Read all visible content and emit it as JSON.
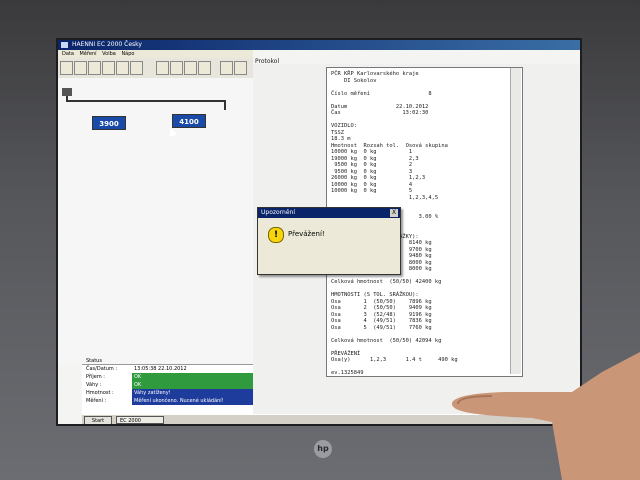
{
  "window": {
    "title": "HAENNI EC 2000 Česky",
    "menu": [
      "Data",
      "Měření",
      "Volba",
      "Nápo"
    ]
  },
  "diagram": {
    "device_left": "3900",
    "device_right": "4100"
  },
  "protocol_label": "Protokol",
  "status": {
    "header": "Status",
    "rows": [
      {
        "label": "Čas/Datum :",
        "value": "13:05:38   22.10.2012",
        "style": "plain"
      },
      {
        "label": "Příjem :",
        "value": "OK",
        "style": "green"
      },
      {
        "label": "Váhy :",
        "value": "OK",
        "style": "green"
      },
      {
        "label": "Hmotnost :",
        "value": "Váhy zatíženy!",
        "style": "blue"
      },
      {
        "label": "Měření :",
        "value": "Měření ukončeno. Nucené ukládání!",
        "style": "blue"
      }
    ]
  },
  "taskbar": {
    "start": "Start",
    "task": "EC 2000"
  },
  "report_lines": [
    "PČR KŘP Karlovarského kraje",
    "    DI Sokolov",
    "",
    "Číslo měření                  8",
    "",
    "Datum               22.10.2012",
    "Čas                   13:02:30",
    "",
    "VOZIDLO:",
    "TSSZ",
    "18.3 m",
    "Hmotnost  Rozsah tol.  Osová skupina",
    "10000 kg  0 kg          1",
    "19000 kg  0 kg          2,3",
    " 9500 kg  0 kg          2",
    " 9500 kg  0 kg          3",
    "26000 kg  0 kg          1,2,3",
    "10000 kg  0 kg          4",
    "10000 kg  0 kg          5",
    "                        1,2,3,4,5",
    "",
    "",
    "                           3.00 %",
    "",
    "",
    "                   SRÁŽKY):",
    "Osa       1  (50/50)    8140 kg",
    "Osa       2  (50/50)    9700 kg",
    "Osa       3  (52/48)    9480 kg",
    "Osa       4  (49/51)    8000 kg",
    "Osa       5  (49/51)    8000 kg",
    "",
    "Celková hmotnost  (50/50) 42400 kg",
    "",
    "HMOTNOSTI (S TOL. SRÁŽKOU):",
    "Osa       1  (50/50)    7896 kg",
    "Osa       2  (50/50)    9409 kg",
    "Osa       3  (52/48)    9196 kg",
    "Osa       4  (49/51)    7836 kg",
    "Osa       5  (49/51)    7760 kg",
    "",
    "Celková hmotnost  (50/50) 42094 kg",
    "",
    "PŘEVÁŽENÍ",
    "Osa(y)      1,2,3      1.4 t     490 kg",
    "",
    "ev.1325849"
  ],
  "dialog": {
    "title": "Upozornění",
    "message": "Převážení!",
    "close": "X",
    "icon": "warning-icon"
  },
  "bezel": {
    "brand": "hp"
  }
}
